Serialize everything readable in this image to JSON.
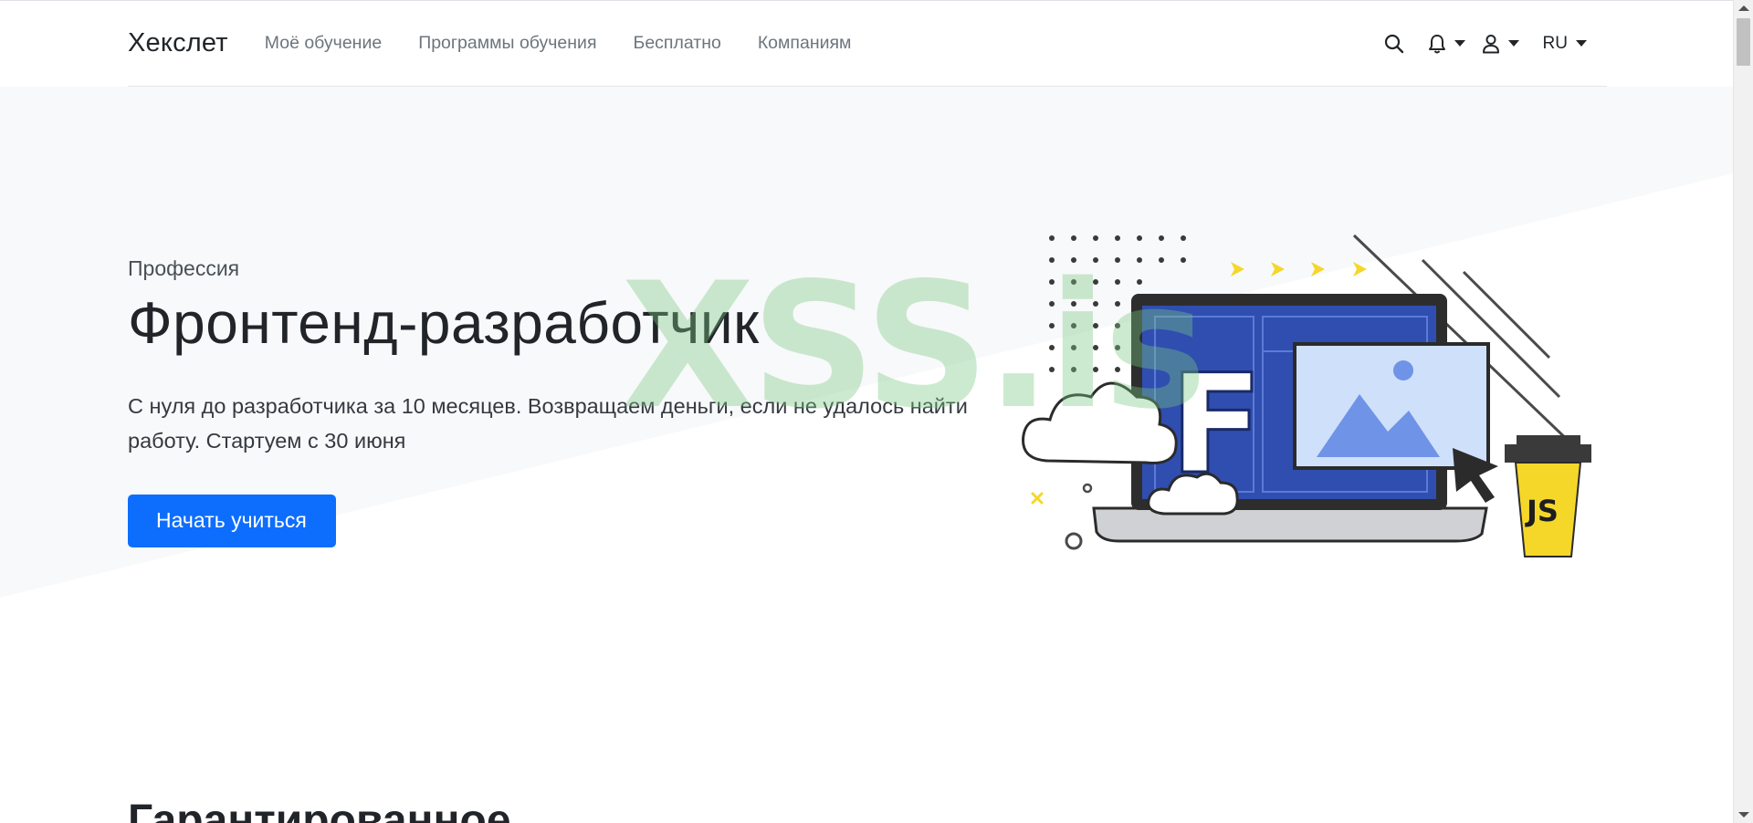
{
  "navbar": {
    "brand": "Хекслет",
    "links": [
      "Моё обучение",
      "Программы обучения",
      "Бесплатно",
      "Компаниям"
    ],
    "icons": [
      "search-icon",
      "bell-icon",
      "user-icon"
    ],
    "language": "RU"
  },
  "hero": {
    "kicker": "Профессия",
    "title": "Фронтенд-разработчик",
    "description": "С нуля до разработчика за 10 месяцев. Возвращаем деньги, если не удалось найти работу. Стартуем с 30 июня",
    "cta_label": "Начать учиться",
    "illustration": {
      "letter": "F",
      "badge": "JS"
    },
    "watermark": "XSS.is"
  },
  "next_section": {
    "heading": "Гарантированное"
  },
  "colors": {
    "accent": "#0d6efd",
    "laptop_screen": "#2f4eb0",
    "js_badge": "#f5d72a",
    "hero_bg": "#f8f9fa"
  }
}
